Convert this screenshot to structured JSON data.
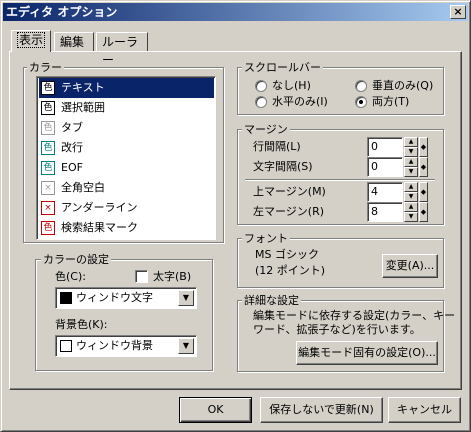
{
  "window": {
    "title": "エディタ オプション",
    "close_glyph": "×"
  },
  "tabs": [
    {
      "label": "表示"
    },
    {
      "label": "編集"
    },
    {
      "label": "ルーラー"
    }
  ],
  "color_group": {
    "label": "カラー",
    "items": [
      {
        "label": "テキスト",
        "icon": "色"
      },
      {
        "label": "選択範囲",
        "icon": "色"
      },
      {
        "label": "タブ",
        "icon": "色"
      },
      {
        "label": "改行",
        "icon": "色"
      },
      {
        "label": "EOF",
        "icon": "色"
      },
      {
        "label": "全角空白",
        "icon": "×"
      },
      {
        "label": "アンダーライン",
        "icon": "×"
      },
      {
        "label": "検索結果マーク",
        "icon": "色"
      }
    ]
  },
  "color_settings": {
    "label": "カラーの設定",
    "fg_label": "色(C):",
    "bold_label": "太字(B)",
    "fg_value": "ウィンドウ文字",
    "bg_label": "背景色(K):",
    "bg_value": "ウィンドウ背景",
    "fg_swatch": "#000000",
    "bg_swatch": "#ffffff"
  },
  "scrollbar": {
    "label": "スクロールバー",
    "options": [
      "なし(H)",
      "垂直のみ(Q)",
      "水平のみ(I)",
      "両方(T)"
    ],
    "selected": "両方(T)"
  },
  "margin": {
    "label": "マージン",
    "fields": [
      {
        "label": "行間隔(L)",
        "value": "0"
      },
      {
        "label": "文字間隔(S)",
        "value": "0"
      },
      {
        "label": "上マージン(M)",
        "value": "4"
      },
      {
        "label": "左マージン(R)",
        "value": "8"
      }
    ]
  },
  "font": {
    "label": "フォント",
    "name": "MS ゴシック",
    "size": "(12 ポイント)",
    "change_button": "変更(A)..."
  },
  "advanced": {
    "label": "詳細な設定",
    "description_line1": "編集モードに依存する設定(カラー、キー",
    "description_line2": "ワード、拡張子など)を行います。",
    "button": "編集モード固有の設定(O)..."
  },
  "footer": {
    "ok": "OK",
    "update": "保存しないで更新(N)",
    "cancel": "キャンセル"
  },
  "colors": {
    "title_start": "#0a246a",
    "title_end": "#a6caf0",
    "selection": "#0a246a",
    "underline_icon": "#cc0000",
    "search_icon": "#cc0000",
    "tab_icon": "#999999",
    "eol_icon": "#008080",
    "eof_icon": "#008080"
  }
}
